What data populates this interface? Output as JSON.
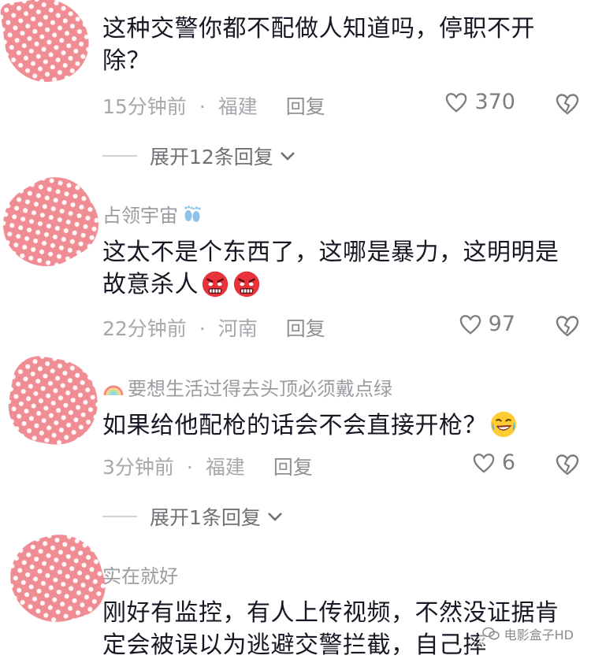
{
  "comments": [
    {
      "text": "这种交警你都不配做人知道吗，停职不开除？",
      "time": "15分钟前",
      "location": "福建",
      "reply_label": "回复",
      "likes": "370",
      "expand_label": "展开12条回复"
    },
    {
      "username": "占领宇宙",
      "username_icon": "footprints-icon",
      "text": "这太不是个东西了，这哪是暴力，这明明是故意杀人",
      "emojis": [
        "angry-face-icon",
        "angry-face-icon"
      ],
      "time": "22分钟前",
      "location": "河南",
      "reply_label": "回复",
      "likes": "97"
    },
    {
      "username": "要想生活过得去头顶必须戴点绿",
      "username_icon": "rainbow-icon",
      "text": "如果给他配枪的话会不会直接开枪？",
      "emojis": [
        "laughing-face-icon"
      ],
      "time": "3分钟前",
      "location": "福建",
      "reply_label": "回复",
      "likes": "6",
      "expand_label": "展开1条回复"
    },
    {
      "username": "实在就好",
      "text": "刚好有监控，有人上传视频，不然没证据肯定会被误以为逃避交警拦截，自己摔"
    }
  ],
  "separator_dot": "·",
  "watermark": "电影盒子HD",
  "colors": {
    "avatar_pink": "#f08c93",
    "text": "#161823",
    "meta": "#a7a8ad",
    "angry_red": "#e8333a"
  }
}
